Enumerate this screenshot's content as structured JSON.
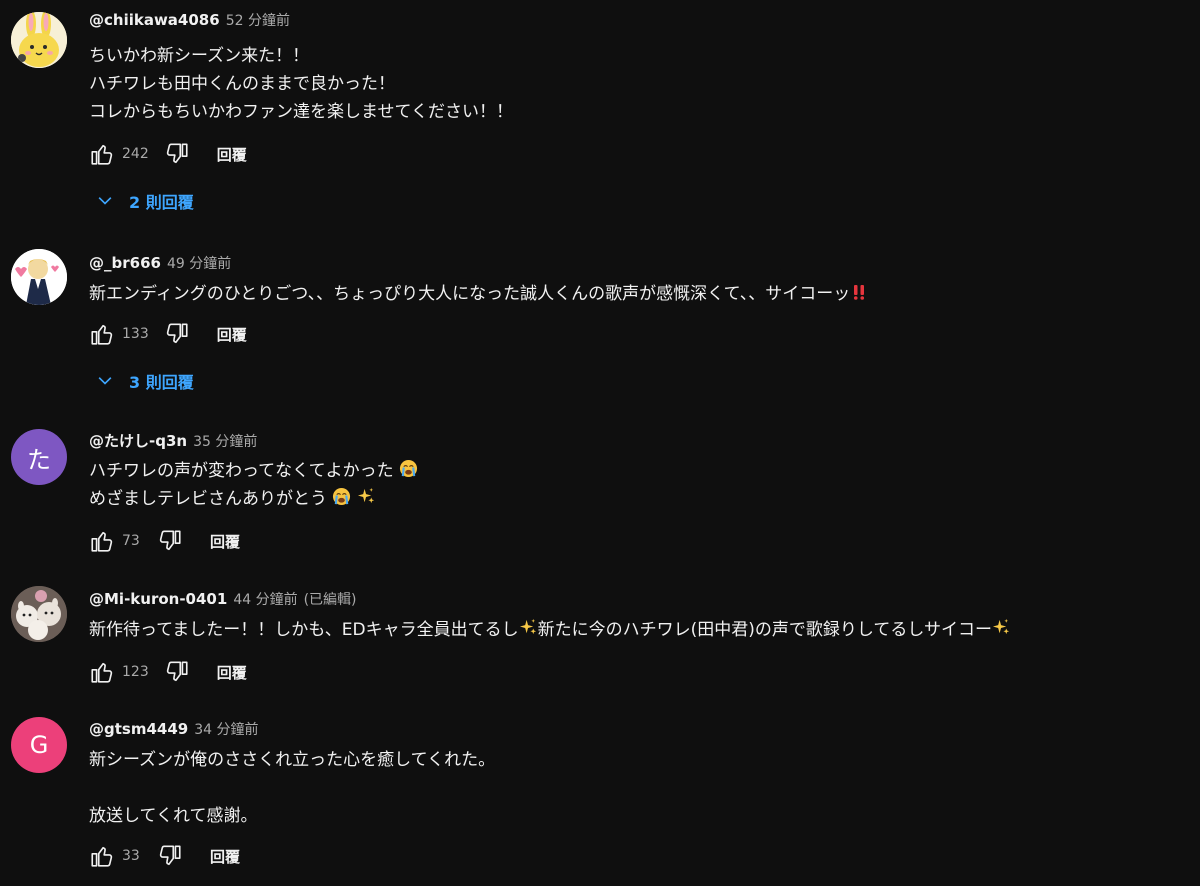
{
  "colors": {
    "background": "#0f0f0f",
    "text": "#f1f1f1",
    "muted": "#aaaaaa",
    "link": "#3ea6ff",
    "avatar_ta": "#7e57c2",
    "avatar_g": "#ec407a"
  },
  "comments": [
    {
      "author": "@chiikawa4086",
      "time": "52 分鐘前",
      "lines": [
        "ちいかわ新シーズン来た！！",
        "ハチワレも田中くんのままで良かった！",
        "コレからもちいかわファン達を楽しませてください！！"
      ],
      "likes": "242",
      "reply_label": "回覆",
      "replies_toggle": "2 則回覆",
      "avatar_icon": "yellow-rabbit-avatar"
    },
    {
      "author": "@_br666",
      "time": "49 分鐘前",
      "lines": [
        "新エンディングのひとりごつ、、ちょっぴり大人になった誠人くんの歌声が感慨深くて、、サイコーッ"
      ],
      "likes": "133",
      "reply_label": "回覆",
      "replies_toggle": "3 則回覆",
      "avatar_icon": "anime-character-avatar"
    },
    {
      "author": "@たけし-q3n",
      "time": "35 分鐘前",
      "lines": [
        "ハチワレの声が変わってなくてよかった",
        "めざましテレビさんありがとう"
      ],
      "likes": "73",
      "reply_label": "回覆",
      "avatar_letter": "た"
    },
    {
      "author": "@Mi-kuron-0401",
      "time": "44 分鐘前",
      "edited": "(已編輯)",
      "lines_parts": [
        "新作待ってましたー！！しかも、EDキャラ全員出てるし",
        "新たに今のハチワレ(田中君)の声で歌録りしてるしサイコー"
      ],
      "likes": "123",
      "reply_label": "回覆",
      "avatar_icon": "plush-toys-avatar"
    },
    {
      "author": "@gtsm4449",
      "time": "34 分鐘前",
      "lines": [
        "新シーズンが俺のささくれ立った心を癒してくれた。",
        "",
        "放送してくれて感謝。"
      ],
      "likes": "33",
      "reply_label": "回覆",
      "avatar_letter": "G"
    }
  ]
}
